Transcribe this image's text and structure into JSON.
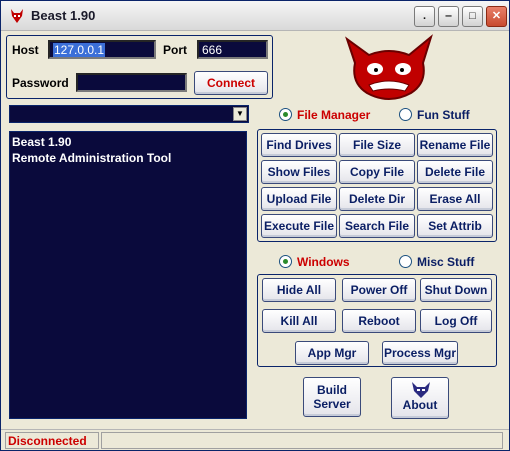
{
  "window": {
    "title": "Beast 1.90"
  },
  "connection": {
    "host_label": "Host",
    "host_value": "127.0.0.1",
    "port_label": "Port",
    "port_value": "666",
    "password_label": "Password",
    "password_value": "",
    "connect_label": "Connect"
  },
  "output": {
    "lines": [
      "Beast 1.90",
      "Remote Administration Tool"
    ]
  },
  "tabs_top": {
    "file_manager": {
      "label": "File Manager",
      "selected": true
    },
    "fun_stuff": {
      "label": "Fun Stuff",
      "selected": false
    }
  },
  "file_buttons": [
    "Find Drives",
    "File Size",
    "Rename File",
    "Show Files",
    "Copy File",
    "Delete File",
    "Upload File",
    "Delete Dir",
    "Erase All",
    "Execute File",
    "Search File",
    "Set Attrib"
  ],
  "tabs_bottom": {
    "windows": {
      "label": "Windows",
      "selected": true
    },
    "misc_stuff": {
      "label": "Misc Stuff",
      "selected": false
    }
  },
  "windows_buttons": [
    "Hide All",
    "Power Off",
    "Shut Down",
    "Kill All",
    "Reboot",
    "Log Off",
    "App Mgr",
    "Process Mgr"
  ],
  "actions": {
    "build_server": "Build\nServer",
    "about": "About"
  },
  "status": {
    "text": "Disconnected"
  },
  "colors": {
    "field_bg": "#0a0a3c",
    "accent_red": "#cc0000",
    "button_text": "#0a1e64"
  }
}
